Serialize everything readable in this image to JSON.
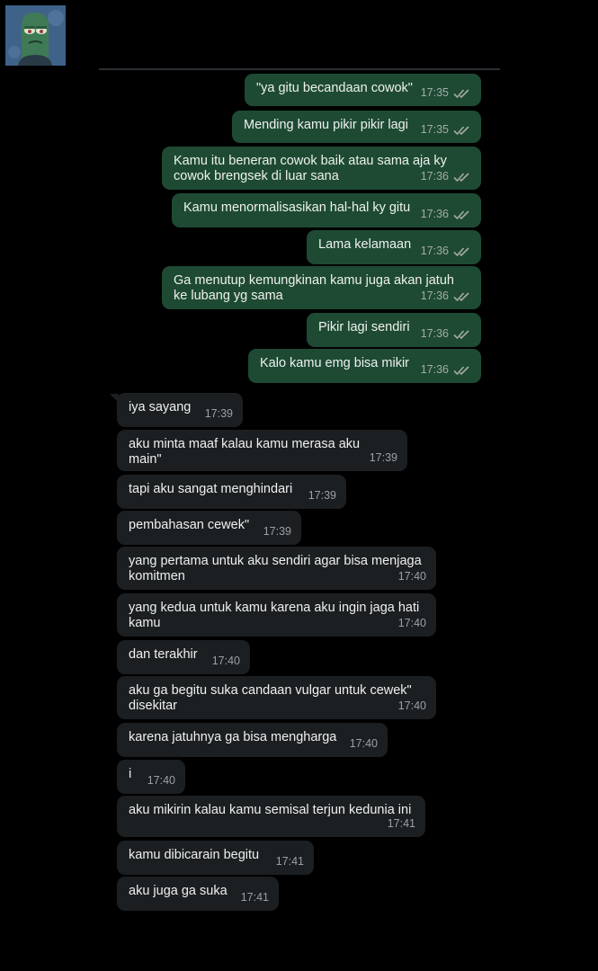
{
  "contact": {
    "avatar": "contact-avatar-image"
  },
  "outgoing": [
    {
      "text": "\"ya gitu becandaan cowok\"",
      "time": "17:35"
    },
    {
      "text": "Mending kamu pikir pikir lagi",
      "time": "17:35"
    },
    {
      "text": "Kamu itu beneran cowok baik atau sama aja ky\ncowok brengsek di luar sana",
      "time": "17:36"
    },
    {
      "text": "Kamu menormalisasikan hal-hal ky gitu",
      "time": "17:36"
    },
    {
      "text": "Lama kelamaan",
      "time": "17:36"
    },
    {
      "text": "Ga menutup kemungkinan kamu juga akan jatuh\nke lubang yg sama",
      "time": "17:36"
    },
    {
      "text": "Pikir lagi sendiri",
      "time": "17:36"
    },
    {
      "text": "Kalo kamu emg bisa mikir",
      "time": "17:36"
    }
  ],
  "incoming": [
    {
      "text": "iya sayang",
      "time": "17:39"
    },
    {
      "text": "aku minta maaf kalau kamu merasa aku main\"",
      "time": "17:39"
    },
    {
      "text": "tapi aku sangat menghindari",
      "time": "17:39"
    },
    {
      "text": "pembahasan cewek\"",
      "time": "17:39"
    },
    {
      "text": "yang pertama untuk aku sendiri agar bisa menjaga\nkomitmen",
      "time": "17:40"
    },
    {
      "text": "yang kedua untuk kamu karena aku ingin jaga hati\nkamu",
      "time": "17:40"
    },
    {
      "text": "dan terakhir",
      "time": "17:40"
    },
    {
      "text": "aku ga begitu suka candaan vulgar untuk cewek\"\ndisekitar",
      "time": "17:40"
    },
    {
      "text": "karena jatuhnya ga bisa mengharga",
      "time": "17:40"
    },
    {
      "text": "i",
      "time": "17:40"
    },
    {
      "text": "aku mikirin kalau kamu semisal terjun kedunia ini",
      "time": "17:41"
    },
    {
      "text": "kamu dibicarain begitu",
      "time": "17:41"
    },
    {
      "text": "aku juga ga suka",
      "time": "17:41"
    }
  ],
  "colors": {
    "outgoing_bubble": "#1e4a33",
    "incoming_bubble": "#1c1f22",
    "background": "#000000",
    "read_ticks": "#a4aaa7"
  },
  "icons": {
    "read_receipt": "double-check-icon"
  }
}
